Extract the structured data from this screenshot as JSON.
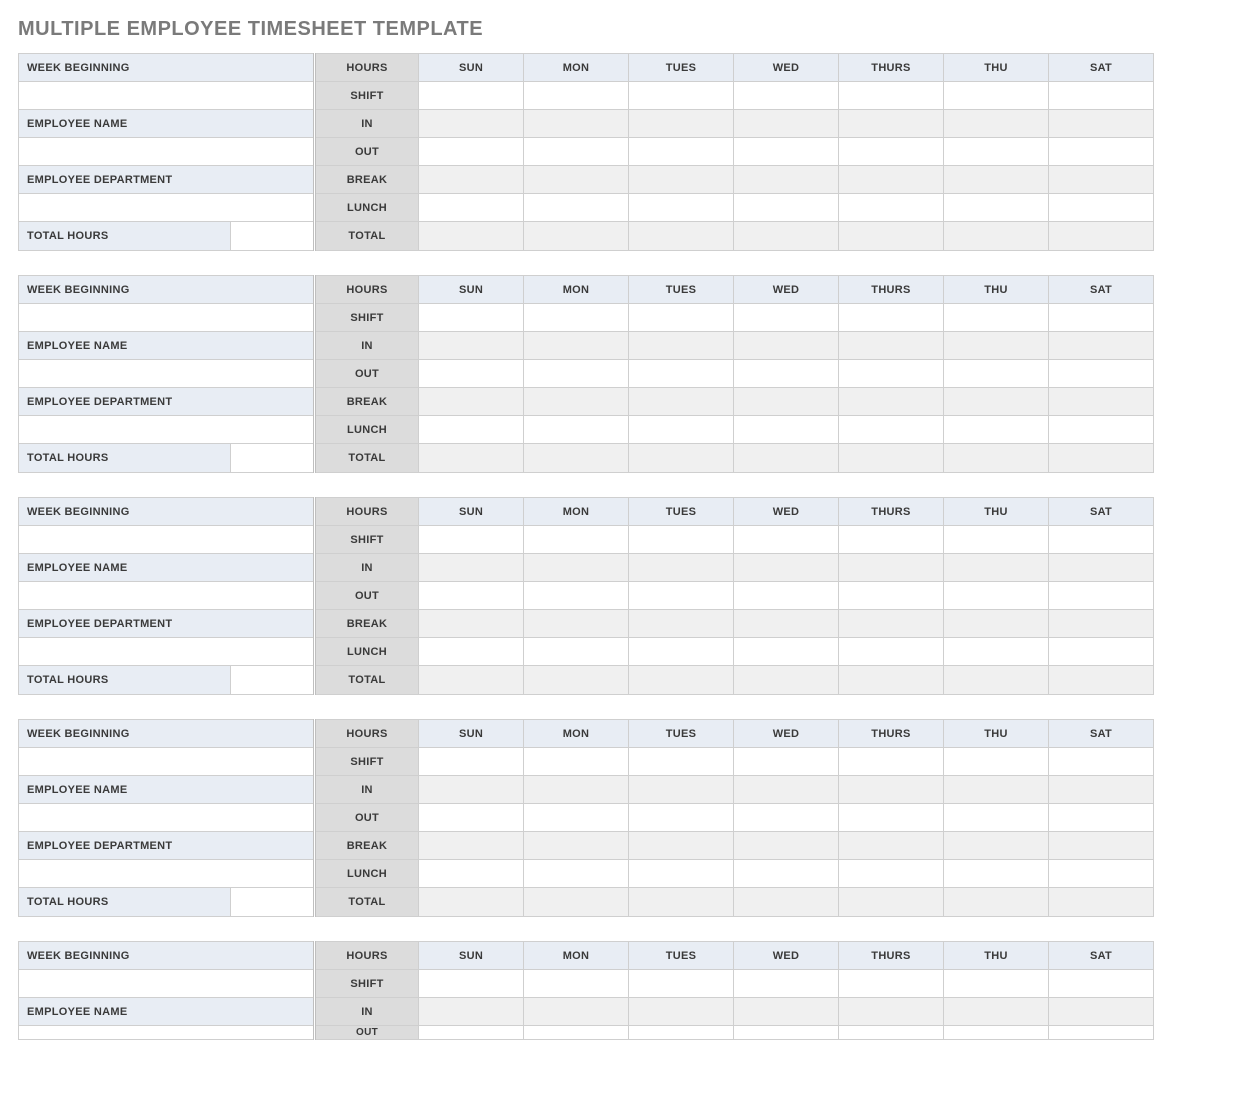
{
  "title": "MULTIPLE EMPLOYEE TIMESHEET TEMPLATE",
  "labels": {
    "week_beginning": "WEEK BEGINNING",
    "employee_name": "EMPLOYEE NAME",
    "employee_department": "EMPLOYEE DEPARTMENT",
    "total_hours": "TOTAL HOURS",
    "hours": "HOURS",
    "shift": "SHIFT",
    "in": "IN",
    "out": "OUT",
    "break": "BREAK",
    "lunch": "LUNCH",
    "total": "TOTAL"
  },
  "days": [
    "SUN",
    "MON",
    "TUES",
    "WED",
    "THURS",
    "THU",
    "SAT"
  ],
  "employees": [
    {
      "week_beginning": "",
      "name": "",
      "department": "",
      "total_hours": "",
      "shift": [
        "",
        "",
        "",
        "",
        "",
        "",
        ""
      ],
      "in": [
        "",
        "",
        "",
        "",
        "",
        "",
        ""
      ],
      "out": [
        "",
        "",
        "",
        "",
        "",
        "",
        ""
      ],
      "break": [
        "",
        "",
        "",
        "",
        "",
        "",
        ""
      ],
      "lunch": [
        "",
        "",
        "",
        "",
        "",
        "",
        ""
      ],
      "total": [
        "",
        "",
        "",
        "",
        "",
        "",
        ""
      ]
    },
    {
      "week_beginning": "",
      "name": "",
      "department": "",
      "total_hours": "",
      "shift": [
        "",
        "",
        "",
        "",
        "",
        "",
        ""
      ],
      "in": [
        "",
        "",
        "",
        "",
        "",
        "",
        ""
      ],
      "out": [
        "",
        "",
        "",
        "",
        "",
        "",
        ""
      ],
      "break": [
        "",
        "",
        "",
        "",
        "",
        "",
        ""
      ],
      "lunch": [
        "",
        "",
        "",
        "",
        "",
        "",
        ""
      ],
      "total": [
        "",
        "",
        "",
        "",
        "",
        "",
        ""
      ]
    },
    {
      "week_beginning": "",
      "name": "",
      "department": "",
      "total_hours": "",
      "shift": [
        "",
        "",
        "",
        "",
        "",
        "",
        ""
      ],
      "in": [
        "",
        "",
        "",
        "",
        "",
        "",
        ""
      ],
      "out": [
        "",
        "",
        "",
        "",
        "",
        "",
        ""
      ],
      "break": [
        "",
        "",
        "",
        "",
        "",
        "",
        ""
      ],
      "lunch": [
        "",
        "",
        "",
        "",
        "",
        "",
        ""
      ],
      "total": [
        "",
        "",
        "",
        "",
        "",
        "",
        ""
      ]
    },
    {
      "week_beginning": "",
      "name": "",
      "department": "",
      "total_hours": "",
      "shift": [
        "",
        "",
        "",
        "",
        "",
        "",
        ""
      ],
      "in": [
        "",
        "",
        "",
        "",
        "",
        "",
        ""
      ],
      "out": [
        "",
        "",
        "",
        "",
        "",
        "",
        ""
      ],
      "break": [
        "",
        "",
        "",
        "",
        "",
        "",
        ""
      ],
      "lunch": [
        "",
        "",
        "",
        "",
        "",
        "",
        ""
      ],
      "total": [
        "",
        "",
        "",
        "",
        "",
        "",
        ""
      ]
    },
    {
      "week_beginning": "",
      "name": "",
      "department": "",
      "total_hours": "",
      "shift": [
        "",
        "",
        "",
        "",
        "",
        "",
        ""
      ],
      "in": [
        "",
        "",
        "",
        "",
        "",
        "",
        ""
      ],
      "out": [
        "",
        "",
        "",
        "",
        "",
        "",
        ""
      ],
      "break": [
        "",
        "",
        "",
        "",
        "",
        "",
        ""
      ],
      "lunch": [
        "",
        "",
        "",
        "",
        "",
        "",
        ""
      ],
      "total": [
        "",
        "",
        "",
        "",
        "",
        "",
        ""
      ]
    }
  ]
}
